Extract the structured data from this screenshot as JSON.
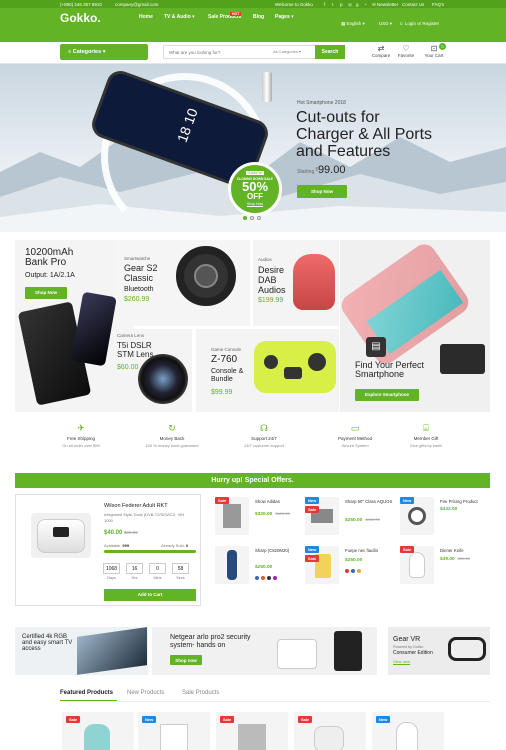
{
  "topbar": {
    "phone": "(+890) 246 357 8910",
    "email": "company@gmail.com",
    "welcome": "Welcome to Gokko",
    "social_icons": [
      "facebook-icon",
      "twitter-icon",
      "pinterest-icon",
      "instagram-icon",
      "google-icon",
      "rss-icon"
    ],
    "newsletter": "Newsletter",
    "contact": "Contact Us",
    "faq": "FAQ's"
  },
  "header": {
    "logo": "Gokko.",
    "nav": [
      "Home",
      "TV & Audio",
      "Sale Products",
      "Blog",
      "Pages"
    ],
    "hot_badge": "HOT",
    "language": "English",
    "currency": "USD",
    "login": "Login or Register"
  },
  "searchbar": {
    "categories_label": "Categories",
    "search_placeholder": "What are you looking for?",
    "all_categories": "All Categories",
    "search_button": "Search",
    "compare": "Compare",
    "favorite": "Favorite",
    "cart": "Your Cart",
    "cart_count": "0"
  },
  "hero": {
    "kicker": "Hot Smartphone 2018",
    "title_line1": "Cut-outs for",
    "title_line2": "Charger & All Ports",
    "title_line3": "and Features",
    "starting": "Starting",
    "price": "99.00",
    "price_currency": "$",
    "shop_button": "Shop Now",
    "sale_top": "Gokko.vn",
    "sale_label": "CLOSING DOWN SALE",
    "sale_pct": "50%",
    "sale_off": "OFF",
    "sale_link": "Shop Now",
    "dots": 3,
    "phone_time": "18 10"
  },
  "promos": {
    "powerbank": {
      "title": "10200mAh Bank Pro",
      "sub": "Output: 1A/2.1A",
      "button": "Shop Now"
    },
    "watch": {
      "cat": "Smartwatche",
      "title": "Gear S2 Classic",
      "sub": "Bluetooth",
      "price": "$260.99"
    },
    "audio": {
      "cat": "Audios",
      "title": "Desire DAB Audios",
      "price": "$199.99"
    },
    "smartphone": {
      "title": "Find Your Perfect Smartphone",
      "button": "Explore Smartphone"
    },
    "lens": {
      "cat": "Camera Lens",
      "title": "T5i DSLR STM Lens",
      "price": "$60.00"
    },
    "console": {
      "cat": "Game Console",
      "title": "Z-760",
      "sub": "Console & Bundle",
      "price": "$99.99"
    }
  },
  "features": [
    {
      "icon": "plane-icon",
      "title": "Free Shipping",
      "sub": "On all order over $99"
    },
    {
      "icon": "refresh-icon",
      "title": "Money Back",
      "sub": "100 % money back guarantee"
    },
    {
      "icon": "headset-icon",
      "title": "Support 24/7",
      "sub": "24/7 customer support"
    },
    {
      "icon": "card-icon",
      "title": "Payment Method",
      "sub": "Secure System"
    },
    {
      "icon": "gift-icon",
      "title": "Member Gift",
      "sub": "Give gifts by week"
    }
  ],
  "deals": {
    "banner": "Hurry up! Special Offers.",
    "featured": {
      "name": "Wilson Federer Adult RKT",
      "desc": "Integrated Style-Tonic (DVB-T2/S/S2/C2, VIH 1000",
      "price": "$40.00",
      "old_price": "$80.00",
      "available_label": "Available:",
      "available": "999",
      "sold_label": "Already Sold:",
      "sold": "0",
      "sold_fraction": 0.0,
      "countdown": [
        {
          "value": "1068",
          "label": "Days"
        },
        {
          "value": "16",
          "label": "Hrs"
        },
        {
          "value": "0",
          "label": "Mins"
        },
        {
          "value": "58",
          "label": "Secs"
        }
      ],
      "add_to_cart": "Add to Cart"
    },
    "items": [
      {
        "name": "Show Adidas",
        "price": "$320.00",
        "old": "$400.00",
        "badge": ""
      },
      {
        "name": "Sharp 50\" Class AQUOS",
        "price": "$250.00",
        "old": "$450.00",
        "badge": "New"
      },
      {
        "name": "Fire Pricing Product",
        "price": "$432.00",
        "old": "",
        "badge": "New"
      },
      {
        "name": "Sharp (C820M20)",
        "price": "$250.00",
        "old": "",
        "badge": ""
      },
      {
        "name": "Fuepe nec fiacilis",
        "price": "$250.00",
        "old": "",
        "badge": "New"
      },
      {
        "name": "Dinner Knife",
        "price": "$39.00",
        "old": "$50.00",
        "badge": "Sale"
      }
    ],
    "sale_badge": "Sale",
    "new_badge": "New"
  },
  "banners": {
    "tv": "Certified 4k RGB and easy smart TV access",
    "netgear_line1": "Netgear arlo pro2 security",
    "netgear_line2": "system- hands on",
    "netgear_button": "Shop now",
    "vr_title": "Gear VR",
    "vr_sub": "Powered by Gokko",
    "vr_line": "Consumer Edition",
    "vr_link": "View now"
  },
  "products": {
    "tabs": [
      "Featured Products",
      "New Products",
      "Sale Products"
    ],
    "badges": [
      "Sale",
      "New",
      "Sale",
      "Sale",
      "New"
    ]
  },
  "colors": {
    "accent": "#62b325",
    "sale": "#e53935",
    "new": "#1e88e5"
  }
}
